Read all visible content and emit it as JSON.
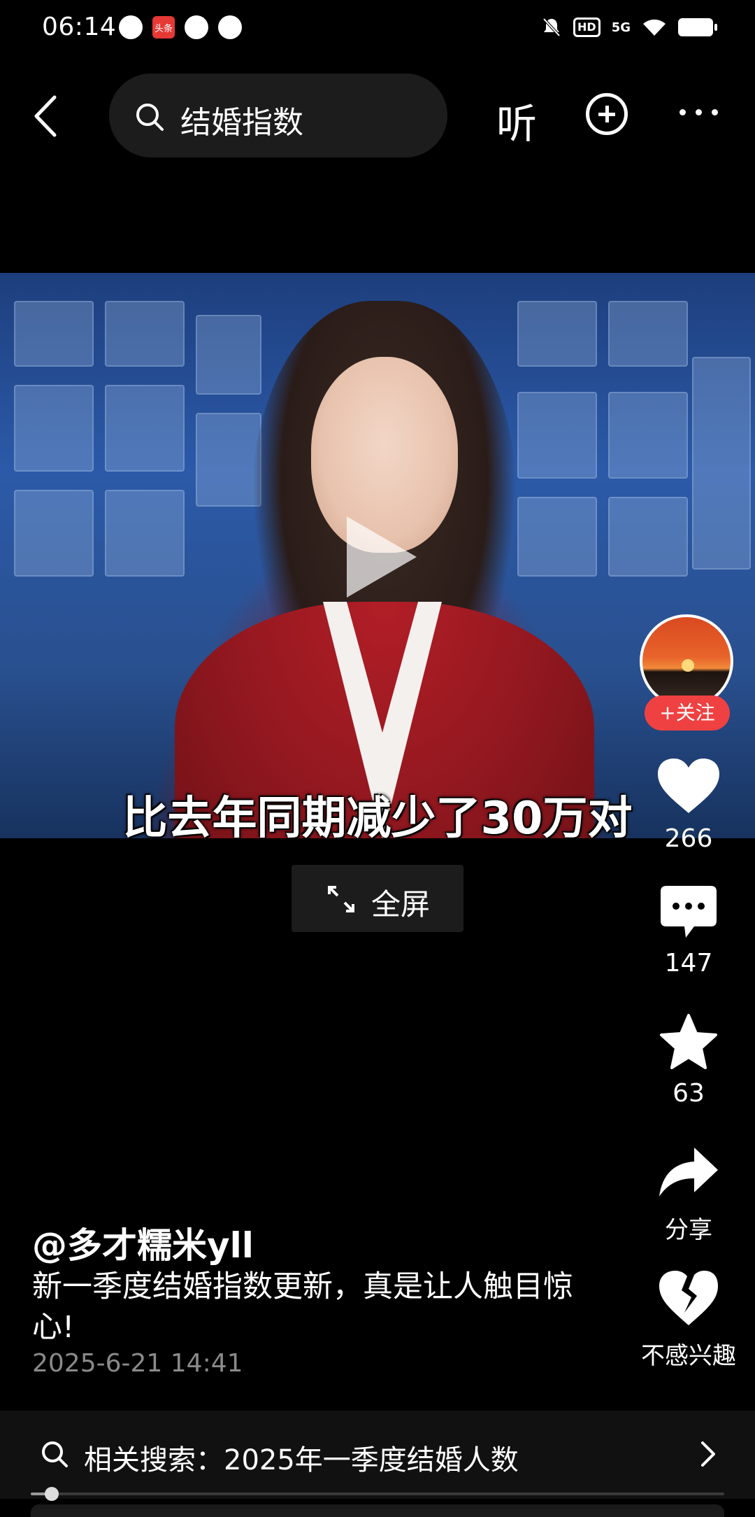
{
  "status_bar": {
    "time": "06:14",
    "network": "5G",
    "hd": "HD",
    "app_badge": "头条"
  },
  "top_bar": {
    "search_query": "结婚指数",
    "listen_label": "听"
  },
  "video": {
    "subtitle": "比去年同期减少了30万对"
  },
  "fullscreen": {
    "label": "全屏"
  },
  "rail": {
    "follow_label": "+关注",
    "likes": "266",
    "comments": "147",
    "favorites": "63",
    "share_label": "分享",
    "dislike_label": "不感兴趣"
  },
  "post": {
    "author": "@多才糯米yll",
    "caption": "新一季度结婚指数更新，真是让人触目惊心!",
    "date": "2025-6-21 14:41"
  },
  "related_search": {
    "text": "相关搜索：2025年一季度结婚人数"
  },
  "playback": {
    "progress_fraction": 0.03
  },
  "colors": {
    "accent_red": "#f04142",
    "background": "#000000",
    "panel": "#1c1c1c"
  }
}
